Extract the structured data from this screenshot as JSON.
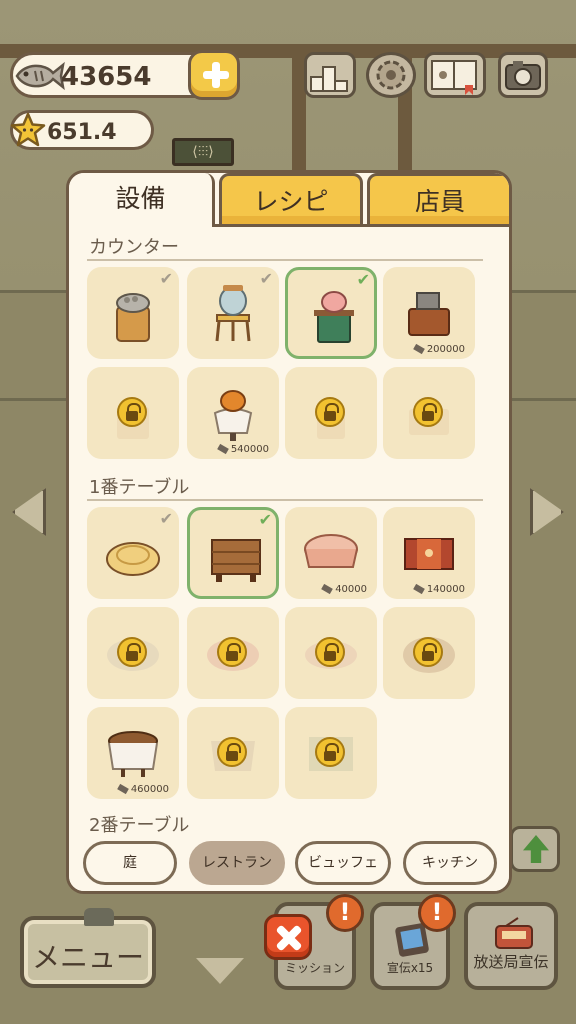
{
  "hud": {
    "fish_count": "43654",
    "star_count": "651.4"
  },
  "modal": {
    "tabs": [
      {
        "label": "設備",
        "active": true
      },
      {
        "label": "レシピ",
        "active": false
      },
      {
        "label": "店員",
        "active": false
      }
    ],
    "sections": [
      {
        "title": "カウンター"
      },
      {
        "title": "1番テーブル"
      },
      {
        "title": "2番テーブル"
      }
    ],
    "counter_items": [
      {
        "state": "owned",
        "price": ""
      },
      {
        "state": "owned",
        "price": ""
      },
      {
        "state": "selected",
        "price": ""
      },
      {
        "state": "buyable",
        "price": "200000"
      },
      {
        "state": "locked",
        "price": ""
      },
      {
        "state": "buyable",
        "price": "540000"
      },
      {
        "state": "locked",
        "price": ""
      },
      {
        "state": "locked",
        "price": ""
      }
    ],
    "table1_items": [
      {
        "state": "owned",
        "price": ""
      },
      {
        "state": "selected",
        "price": ""
      },
      {
        "state": "buyable",
        "price": "40000"
      },
      {
        "state": "buyable",
        "price": "140000"
      },
      {
        "state": "locked",
        "price": ""
      },
      {
        "state": "locked",
        "price": ""
      },
      {
        "state": "locked",
        "price": ""
      },
      {
        "state": "locked",
        "price": ""
      },
      {
        "state": "buyable",
        "price": "460000"
      },
      {
        "state": "locked",
        "price": ""
      },
      {
        "state": "locked",
        "price": ""
      }
    ],
    "floor_tabs": [
      {
        "label": "庭",
        "active": false
      },
      {
        "label": "レストラン",
        "active": true
      },
      {
        "label": "ビュッフェ",
        "active": false
      },
      {
        "label": "キッチン",
        "active": false
      }
    ]
  },
  "bottom_bar": {
    "menu_label": "メニュー",
    "mission_label": "ミッション",
    "ad_label": "宣伝x15",
    "broadcast_label": "放送局宣伝",
    "alert_mark": "!"
  },
  "colors": {
    "accent_yellow": "#f5c64a",
    "selected_green": "#7fb26b",
    "panel_cream": "#fdf7ea",
    "slot_beige": "#f4e6c2",
    "outline_brown": "#6e5a45"
  }
}
